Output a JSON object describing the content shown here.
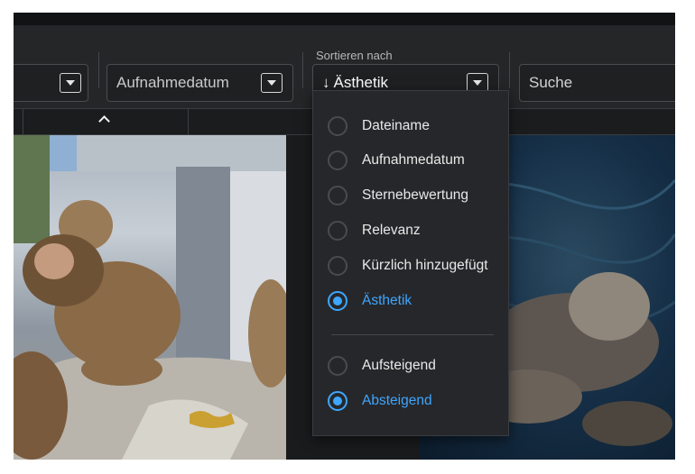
{
  "toolbar": {
    "sort_caption": "Sortieren nach",
    "field2_value": "Aufnahmedatum",
    "sort_value": "Ästhetik",
    "search_placeholder": "Suche"
  },
  "sort_menu": {
    "fields": [
      {
        "label": "Dateiname",
        "selected": false
      },
      {
        "label": "Aufnahmedatum",
        "selected": false
      },
      {
        "label": "Sternebewertung",
        "selected": false
      },
      {
        "label": "Relevanz",
        "selected": false
      },
      {
        "label": "Kürzlich hinzugefügt",
        "selected": false
      },
      {
        "label": "Ästhetik",
        "selected": true
      }
    ],
    "order": [
      {
        "label": "Aufsteigend",
        "selected": false
      },
      {
        "label": "Absteigend",
        "selected": true
      }
    ]
  },
  "colors": {
    "accent": "#3ea6ff",
    "panel": "#26272a",
    "background": "#1f2022"
  },
  "icons": {
    "sort_arrow": "arrow-down-icon",
    "collapse": "chevron-up-icon",
    "dropdown": "caret-down-icon"
  }
}
